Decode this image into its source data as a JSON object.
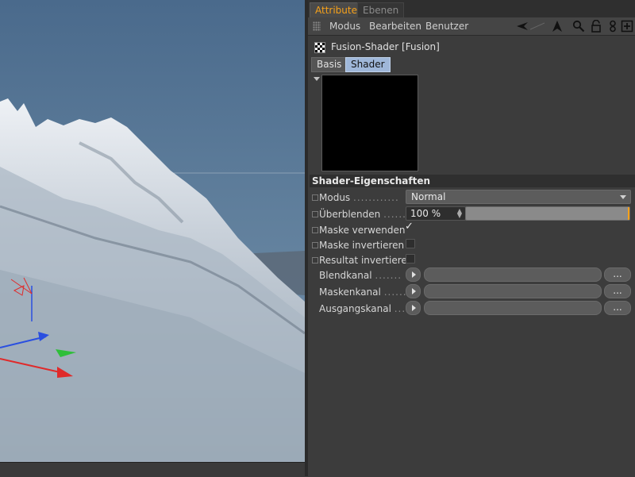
{
  "tabs": [
    {
      "label": "Attribute",
      "active": true
    },
    {
      "label": "Ebenen",
      "active": false
    }
  ],
  "menu": {
    "items": [
      "Modus",
      "Bearbeiten",
      "Benutzer"
    ],
    "tools": [
      "back-arrow-icon",
      "forward-arrow-icon",
      "search-icon",
      "lock-icon",
      "link-icon",
      "new-panel-icon"
    ]
  },
  "object": {
    "title": "Fusion-Shader [Fusion]",
    "icon": "checker-shader-icon"
  },
  "subtabs": [
    {
      "label": "Basis",
      "active": false
    },
    {
      "label": "Shader",
      "active": true
    }
  ],
  "section_title": "Shader-Eigenschaften",
  "fields": {
    "modus": {
      "label": "Modus",
      "dots": "............",
      "value": "Normal"
    },
    "ueberblenden": {
      "label": "Überblenden",
      "dots": "......",
      "value": "100 %",
      "level": 1.0
    },
    "maske_verwenden": {
      "label": "Maske verwenden",
      "checked": true
    },
    "maske_invertieren": {
      "label": "Maske invertieren",
      "checked": false
    },
    "resultat_invertieren": {
      "label": "Resultat invertieren",
      "checked": false
    },
    "blendkanal": {
      "label": "Blendkanal",
      "dots": ".......",
      "button": "..."
    },
    "maskenkanal": {
      "label": "Maskenkanal",
      "dots": "......",
      "button": "..."
    },
    "ausgangskanal": {
      "label": "Ausgangskanal",
      "dots": "....",
      "button": "..."
    }
  },
  "colors": {
    "accent": "#f6a11a",
    "panel_bg": "#3c3c3c",
    "active_subtab": "#9fb7d9",
    "axis_x": "#e02a2a",
    "axis_y": "#2fbf3a",
    "axis_z": "#2a4fe0"
  }
}
